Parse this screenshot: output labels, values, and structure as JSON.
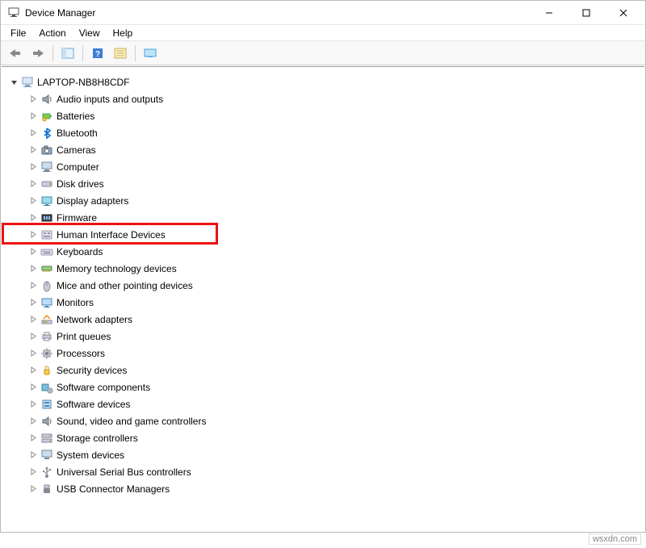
{
  "window": {
    "title": "Device Manager"
  },
  "menubar": [
    {
      "label": "File"
    },
    {
      "label": "Action"
    },
    {
      "label": "View"
    },
    {
      "label": "Help"
    }
  ],
  "tree": {
    "root": "LAPTOP-NB8H8CDF",
    "items": [
      {
        "label": "Audio inputs and outputs",
        "icon": "speaker"
      },
      {
        "label": "Batteries",
        "icon": "battery"
      },
      {
        "label": "Bluetooth",
        "icon": "bluetooth"
      },
      {
        "label": "Cameras",
        "icon": "camera"
      },
      {
        "label": "Computer",
        "icon": "computer"
      },
      {
        "label": "Disk drives",
        "icon": "disk"
      },
      {
        "label": "Display adapters",
        "icon": "display"
      },
      {
        "label": "Firmware",
        "icon": "firmware"
      },
      {
        "label": "Human Interface Devices",
        "icon": "hid",
        "highlighted": true
      },
      {
        "label": "Keyboards",
        "icon": "keyboard"
      },
      {
        "label": "Memory technology devices",
        "icon": "memory"
      },
      {
        "label": "Mice and other pointing devices",
        "icon": "mouse"
      },
      {
        "label": "Monitors",
        "icon": "monitor"
      },
      {
        "label": "Network adapters",
        "icon": "network"
      },
      {
        "label": "Print queues",
        "icon": "printer"
      },
      {
        "label": "Processors",
        "icon": "cpu"
      },
      {
        "label": "Security devices",
        "icon": "security"
      },
      {
        "label": "Software components",
        "icon": "swcomp"
      },
      {
        "label": "Software devices",
        "icon": "swdev"
      },
      {
        "label": "Sound, video and game controllers",
        "icon": "sound"
      },
      {
        "label": "Storage controllers",
        "icon": "storage"
      },
      {
        "label": "System devices",
        "icon": "system"
      },
      {
        "label": "Universal Serial Bus controllers",
        "icon": "usb"
      },
      {
        "label": "USB Connector Managers",
        "icon": "usbconn"
      }
    ]
  },
  "watermark": "wsxdn.com"
}
